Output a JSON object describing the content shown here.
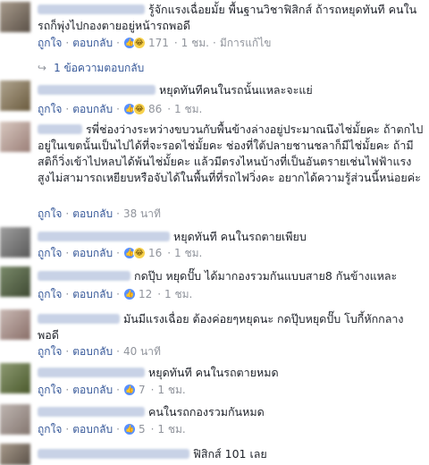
{
  "comments": [
    {
      "text": "รู้จักแรงเฉื่อยมั้ย พื้นฐานวิชาฟิสิกส์ ถ้ารถหยุดทันที คนในรถก็พุ่งไปกองตายอยู่หน้ารถพอดี",
      "like_label": "ถูกใจ",
      "reply_label": "ตอบกลับ",
      "reactions": [
        "like-icon",
        "haha-icon"
      ],
      "count": "171",
      "time": "1 ชม.",
      "edited": "มีการแก้ไข",
      "replies_link": "1 ข้อความตอบกลับ"
    },
    {
      "text": "หยุดทันทีคนในรถนั้นแหละจะแย่",
      "like_label": "ถูกใจ",
      "reply_label": "ตอบกลับ",
      "reactions": [
        "like-icon",
        "haha-icon"
      ],
      "count": "86",
      "time": "1 ชม."
    },
    {
      "text": "รพี่ช่องว่างระหว่างขบวนกับพื้นข้างล่างอยู่ประมาณนึงไช่มั้ยคะ ถ้าตกไปอยู่ในเขตนั้นเป็นไปได้ที่จะรอดไช่มั้ยคะ ช่องที่ใต้ปลายชานชลาก็มีไช่มั้ยคะ ถ้ามีสติก็วิ่งเข้าไปหลบได้พ้นไช่มั้ยคะ แล้วมีตรงไหนบ้างที่เป็นอันตรายเช่นไฟฟ้าแรงสูงไม่สามารถเหยียบหรือจับได้ในพื้นที่ที่รถไฟวิ่งคะ อยากได้ความรู้ส่วนนี้หน่อยค่ะ",
      "like_label": "ถูกใจ",
      "reply_label": "ตอบกลับ",
      "time": "38 นาที"
    },
    {
      "text": "หยุดทันที คนในรถตายเพียบ",
      "like_label": "ถูกใจ",
      "reply_label": "ตอบกลับ",
      "reactions": [
        "like-icon",
        "haha-icon"
      ],
      "count": "16",
      "time": "1 ชม."
    },
    {
      "text": "กดปุ๊บ หยุดปั๊บ ได้มากองรวมกันแบบสาย8 กันข้างแหละ",
      "like_label": "ถูกใจ",
      "reply_label": "ตอบกลับ",
      "reactions": [
        "like-icon"
      ],
      "count": "12",
      "time": "1 ชม."
    },
    {
      "text": "มันมีแรงเฉื่อย ต้องค่อยๆหยุดนะ กดปุ๊บหยุดปั๊บ โบกี้หักกลางพอดี",
      "like_label": "ถูกใจ",
      "reply_label": "ตอบกลับ",
      "time": "40 นาที"
    },
    {
      "text": "หยุดทันที คนในรถตายหมด",
      "like_label": "ถูกใจ",
      "reply_label": "ตอบกลับ",
      "reactions": [
        "like-icon"
      ],
      "count": "7",
      "time": "1 ชม."
    },
    {
      "text": "คนในรถกองรวมกันหมด",
      "like_label": "ถูกใจ",
      "reply_label": "ตอบกลับ",
      "reactions": [
        "like-icon"
      ],
      "count": "5",
      "time": "1 ชม."
    },
    {
      "text": "ฟิสิกส์ 101 เลย"
    }
  ],
  "colors": {
    "link": "#365899",
    "muted": "#90949c",
    "like": "#5890ff",
    "haha": "#f7d14c"
  }
}
